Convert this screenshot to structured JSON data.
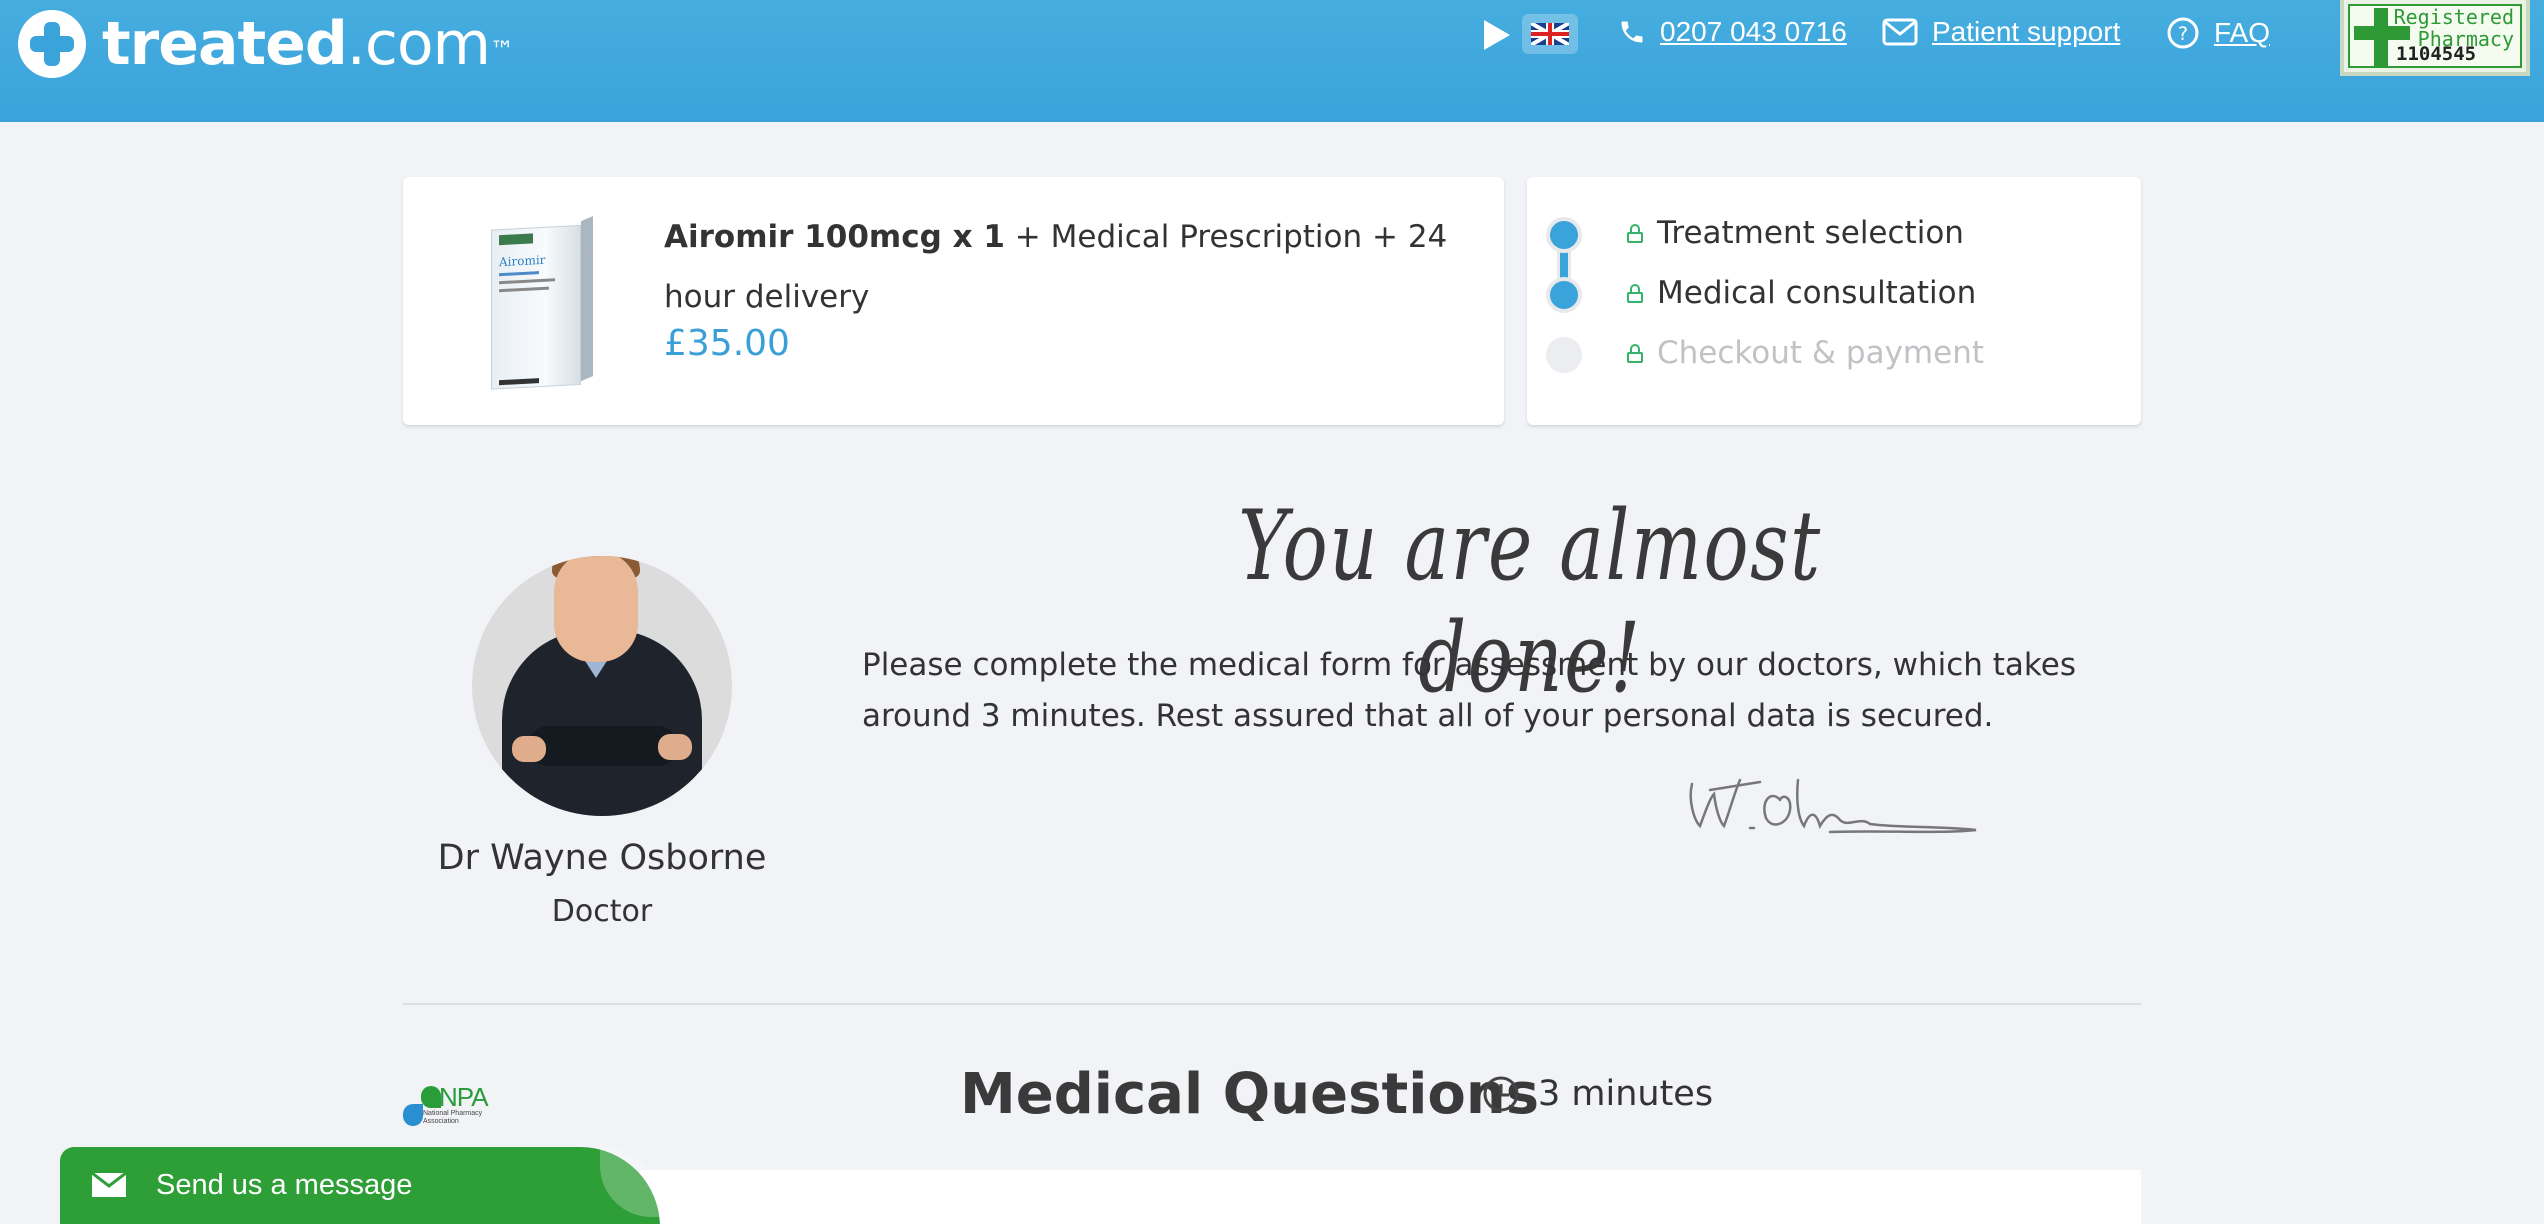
{
  "header": {
    "logo_bold": "treated",
    "logo_light": ".com",
    "logo_tm": "™",
    "phone": "0207 043 0716",
    "patient_support": "Patient support",
    "faq": "FAQ",
    "badge_line1": "Registered",
    "badge_line2": "Pharmacy",
    "badge_number": "1104545"
  },
  "product": {
    "name": "Airomir 100mcg x 1",
    "extras": "  + Medical Prescription + 24 hour delivery",
    "price": "£35.00",
    "box_brand": "Airomir"
  },
  "steps": [
    {
      "label": "Treatment selection",
      "state": "done"
    },
    {
      "label": "Medical consultation",
      "state": "current"
    },
    {
      "label": "Checkout & payment",
      "state": "pending"
    }
  ],
  "doctor": {
    "name": "Dr Wayne Osborne",
    "role": "Doctor"
  },
  "intro": {
    "headline": "You are almost done!",
    "text": "Please complete the medical form for assessment by our doctors, which takes around 3 minutes. Rest assured that all of your personal data is secured."
  },
  "section": {
    "title": "Medical Questions",
    "duration": "3 minutes"
  },
  "npa": {
    "abbr": "NPA",
    "sub_line1": "National Pharmacy",
    "sub_line2": "Association"
  },
  "chat": {
    "label": "Send us a message"
  },
  "colors": {
    "header_blue": "#3aa3d9",
    "price_blue": "#3a9fd8",
    "lock_green": "#36b36a",
    "chat_green": "#2e9e36"
  }
}
